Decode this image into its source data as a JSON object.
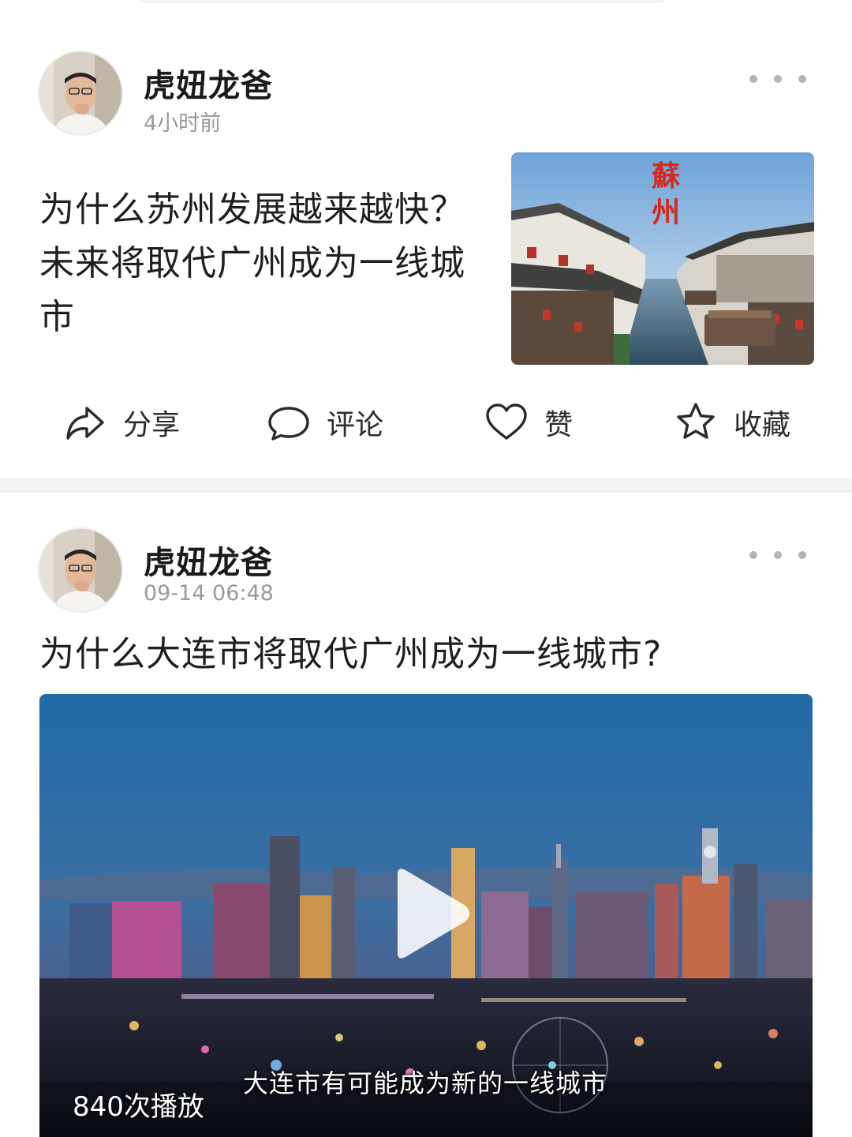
{
  "posts": [
    {
      "author": "虎妞龙爸",
      "time": "4小时前",
      "title": "为什么苏州发展越来越快？未来将取代广州成为一线城市",
      "thumbnail_text": [
        "蘇",
        "州"
      ],
      "actions": [
        {
          "label": "分享",
          "icon": "share-icon"
        },
        {
          "label": "评论",
          "icon": "comment-icon"
        },
        {
          "label": "赞",
          "icon": "like-icon"
        },
        {
          "label": "收藏",
          "icon": "favorite-icon"
        }
      ]
    },
    {
      "author": "虎妞龙爸",
      "time": "09-14 06:48",
      "title": "为什么大连市将取代广州成为一线城市?",
      "video": {
        "play_count": "840次播放",
        "subtitle": "大连市有可能成为新的一线城市",
        "play_icon": "play-icon"
      }
    }
  ],
  "colors": {
    "text": "#1f1f1f",
    "meta": "#9a9a9a",
    "divider": "#f2f2f2",
    "thumbnail_title": "#d32a1e"
  }
}
